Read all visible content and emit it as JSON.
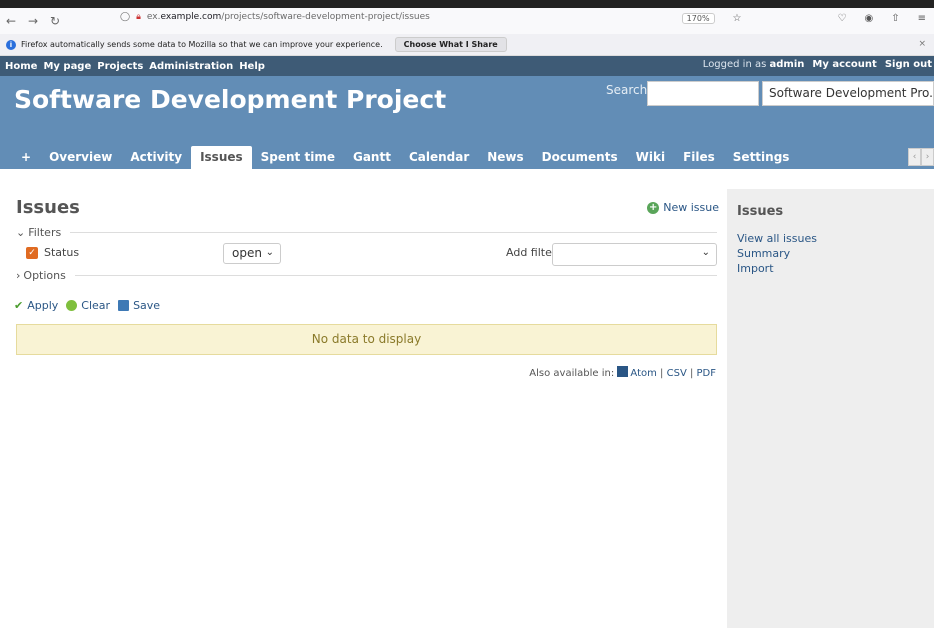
{
  "browser": {
    "url_prefix": "ex.",
    "url_domain": "example.com",
    "url_path": "/projects/software-development-project/issues",
    "zoom": "170%",
    "notice_text": "Firefox automatically sends some data to Mozilla so that we can improve your experience.",
    "notice_button": "Choose What I Share"
  },
  "topmenu": {
    "items": [
      "Home",
      "My page",
      "Projects",
      "Administration",
      "Help"
    ],
    "logged_prefix": "Logged in as ",
    "user": "admin",
    "my_account": "My account",
    "sign_out": "Sign out"
  },
  "header": {
    "title": "Software Development Project",
    "search_label": "Search:",
    "project_jump": "Software Development Pro..."
  },
  "tabs": [
    "+",
    "Overview",
    "Activity",
    "Issues",
    "Spent time",
    "Gantt",
    "Calendar",
    "News",
    "Documents",
    "Wiki",
    "Files",
    "Settings"
  ],
  "selected_tab": "Issues",
  "content": {
    "title": "Issues",
    "new_issue": "New issue",
    "filters_legend": "Filters",
    "filter_status": "Status",
    "filter_operator": "open",
    "add_filter": "Add filter",
    "options_legend": "Options",
    "apply": "Apply",
    "clear": "Clear",
    "save": "Save",
    "no_data": "No data to display",
    "also_available": "Also available in:",
    "formats": [
      "Atom",
      "CSV",
      "PDF"
    ]
  },
  "sidebar": {
    "title": "Issues",
    "links": [
      "View all issues",
      "Summary",
      "Import"
    ]
  }
}
